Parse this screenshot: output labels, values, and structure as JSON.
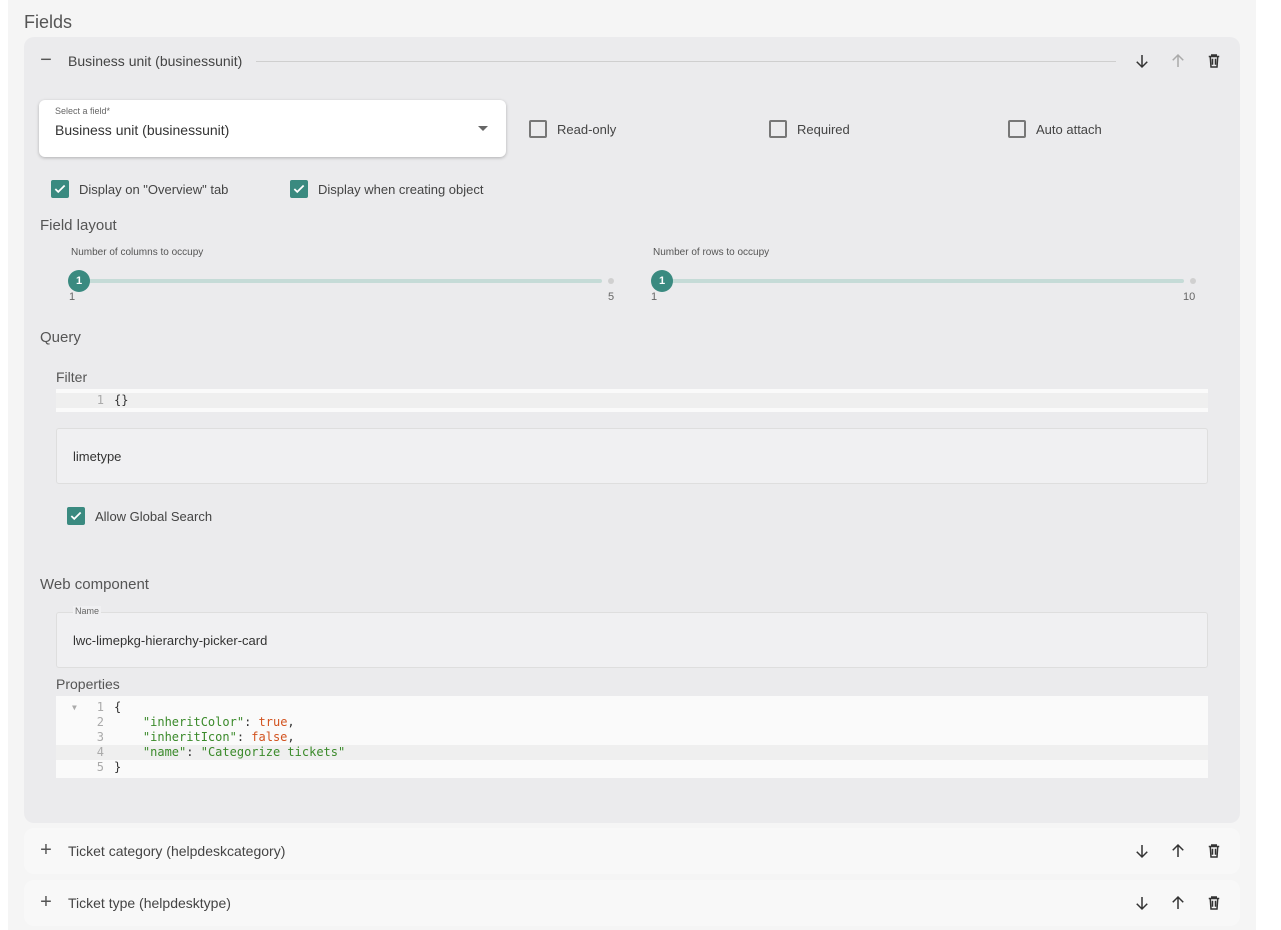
{
  "section": {
    "title": "Fields"
  },
  "fields": [
    {
      "label": "Business unit (businessunit)",
      "expanded": true,
      "toggle_glyph": "−",
      "select": {
        "label": "Select a field*",
        "value": "Business unit (businessunit)"
      },
      "options": [
        {
          "label": "Read-only",
          "checked": false
        },
        {
          "label": "Required",
          "checked": false
        },
        {
          "label": "Auto attach",
          "checked": false
        }
      ],
      "display_options": [
        {
          "label": "Display on \"Overview\" tab",
          "checked": true
        },
        {
          "label": "Display when creating object",
          "checked": true
        }
      ],
      "layout": {
        "title": "Field layout",
        "columns": {
          "label": "Number of columns to occupy",
          "value": 1,
          "min": 1,
          "max": 5,
          "min_label": "1",
          "max_label": "5",
          "value_label": "1"
        },
        "rows": {
          "label": "Number of rows to occupy",
          "value": 1,
          "min": 1,
          "max": 10,
          "min_label": "1",
          "max_label": "10",
          "value_label": "1"
        }
      },
      "query": {
        "title": "Query",
        "filter_title": "Filter",
        "filter_code": [
          {
            "n": "1",
            "text": "{}"
          }
        ],
        "limetype_value": "limetype",
        "allow_global_search": {
          "label": "Allow Global Search",
          "checked": true
        }
      },
      "web_component": {
        "title": "Web component",
        "name_label": "Name",
        "name_value": "lwc-limepkg-hierarchy-picker-card",
        "properties_title": "Properties",
        "properties_code": [
          {
            "n": "1",
            "text": "{"
          },
          {
            "n": "2",
            "key": "\"inheritColor\"",
            "sep": ": ",
            "val": "true",
            "end": ","
          },
          {
            "n": "3",
            "key": "\"inheritIcon\"",
            "sep": ": ",
            "val": "false",
            "end": ","
          },
          {
            "n": "4",
            "key": "\"name\"",
            "sep": ": ",
            "str": "\"Categorize tickets\""
          },
          {
            "n": "5",
            "text": "}"
          }
        ]
      }
    },
    {
      "label": "Ticket category (helpdeskcategory)",
      "expanded": false,
      "toggle_glyph": "+"
    },
    {
      "label": "Ticket type (helpdesktype)",
      "expanded": false,
      "toggle_glyph": "+"
    }
  ],
  "colors": {
    "accent": "#3a8a80",
    "icon": "#444444"
  },
  "icons": {
    "down": "arrow-down-icon",
    "up": "arrow-up-icon",
    "delete": "trash-icon"
  }
}
